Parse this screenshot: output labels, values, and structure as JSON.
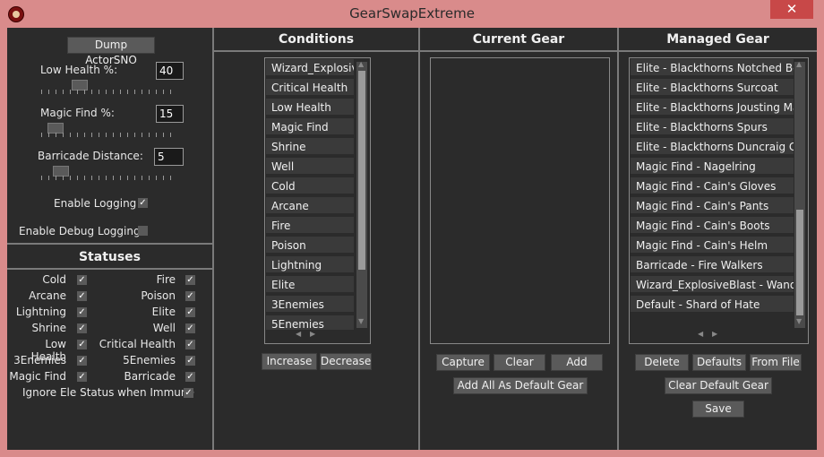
{
  "window": {
    "title": "GearSwapExtreme",
    "close_glyph": "✕"
  },
  "settings": {
    "dump_button": "Dump ActorSNO",
    "low_health": {
      "label": "Low Health %:",
      "value": "40",
      "level": 0.25
    },
    "magic_find": {
      "label": "Magic Find %:",
      "value": "15",
      "level": 0.05
    },
    "barricade": {
      "label": "Barricade Distance:",
      "value": "5",
      "level": 0.1
    },
    "enable_logging": {
      "label": "Enable Logging",
      "checked": true
    },
    "enable_debug_logging": {
      "label": "Enable Debug Logging",
      "checked": false
    }
  },
  "statuses": {
    "title": "Statuses",
    "left": [
      {
        "label": "Cold",
        "checked": true
      },
      {
        "label": "Arcane",
        "checked": true
      },
      {
        "label": "Lightning",
        "checked": true
      },
      {
        "label": "Shrine",
        "checked": true
      },
      {
        "label": "Low Health",
        "checked": true
      },
      {
        "label": "3Enemies",
        "checked": true
      },
      {
        "label": "Magic Find",
        "checked": true
      }
    ],
    "right": [
      {
        "label": "Fire",
        "checked": true
      },
      {
        "label": "Poison",
        "checked": true
      },
      {
        "label": "Elite",
        "checked": true
      },
      {
        "label": "Well",
        "checked": true
      },
      {
        "label": "Critical Health",
        "checked": true
      },
      {
        "label": "5Enemies",
        "checked": true
      },
      {
        "label": "Barricade",
        "checked": true
      }
    ],
    "ignore": {
      "label": "Ignore Ele Status when Immune",
      "checked": true
    }
  },
  "conditions": {
    "title": "Conditions",
    "items": [
      "Wizard_ExplosiveBlast",
      "Critical Health",
      "Low Health",
      "Magic Find",
      "Shrine",
      "Well",
      "Cold",
      "Arcane",
      "Fire",
      "Poison",
      "Lightning",
      "Elite",
      "3Enemies",
      "5Enemies"
    ],
    "increase": "Increase",
    "decrease": "Decrease"
  },
  "current_gear": {
    "title": "Current Gear",
    "items": [],
    "capture": "Capture",
    "clear": "Clear",
    "add": "Add",
    "add_all": "Add All As Default Gear"
  },
  "managed_gear": {
    "title": "Managed Gear",
    "items": [
      "Elite - Blackthorns Notched Belt",
      "Elite - Blackthorns Surcoat",
      "Elite - Blackthorns Jousting Mail",
      "Elite - Blackthorns Spurs",
      "Elite - Blackthorns Duncraig Cross",
      "Magic Find - Nagelring",
      "Magic Find - Cain's Gloves",
      "Magic Find - Cain's Pants",
      "Magic Find - Cain's Boots",
      "Magic Find - Cain's Helm",
      "Barricade - Fire Walkers",
      "Wizard_ExplosiveBlast - Wand of Woh",
      "Default - Shard of Hate"
    ],
    "delete": "Delete",
    "defaults": "Defaults",
    "from_file": "From File",
    "clear_default": "Clear Default Gear",
    "save": "Save"
  }
}
